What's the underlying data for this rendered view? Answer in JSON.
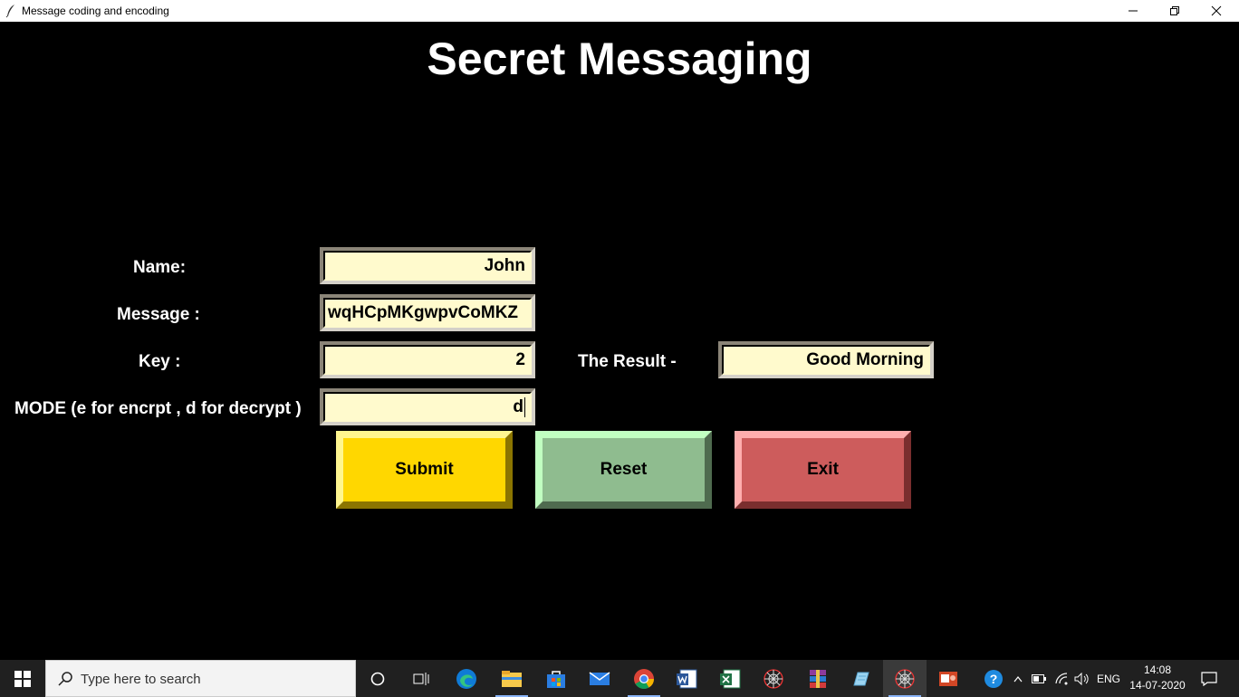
{
  "window": {
    "title": "Message coding and encoding"
  },
  "app": {
    "heading": "Secret Messaging",
    "labels": {
      "name": "Name:",
      "message": "Message :",
      "key": "Key :",
      "mode": "MODE (e for encrpt , d for decrypt )",
      "result": "The Result -"
    },
    "fields": {
      "name": "John",
      "message": "wqHCpMKgwpvCoMKZ",
      "key": "2",
      "mode": "d",
      "result": "Good Morning"
    },
    "buttons": {
      "submit": "Submit",
      "reset": "Reset",
      "exit": "Exit"
    },
    "colors": {
      "background": "#000000",
      "field_bg": "#FFFACD",
      "submit_bg": "#FFD700",
      "reset_bg": "#8FBC8F",
      "exit_bg": "#CD5C5C"
    }
  },
  "taskbar": {
    "search_placeholder": "Type here to search",
    "language": "ENG",
    "time": "14:08",
    "date": "14-07-2020",
    "pinned": [
      "cortana-icon",
      "task-view-icon",
      "edge-icon",
      "file-explorer-icon",
      "store-icon",
      "mail-icon",
      "chrome-icon",
      "word-icon",
      "excel-icon",
      "spider-app-icon",
      "winrar-icon",
      "notepad-icon",
      "python-tk-icon",
      "powerpoint-icon"
    ]
  }
}
